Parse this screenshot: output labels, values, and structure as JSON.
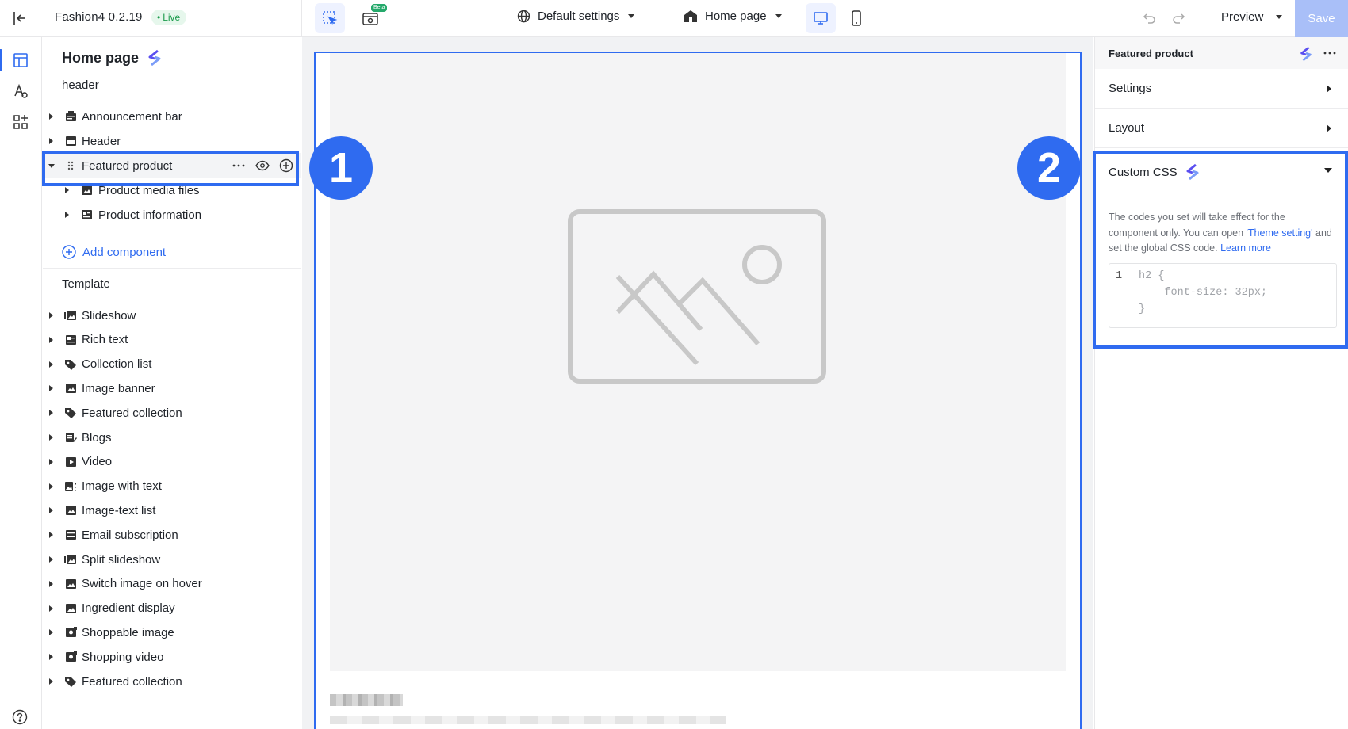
{
  "topbar": {
    "app_name": "Fashion4 0.2.19",
    "live_label": "Live",
    "beta_label": "Beta",
    "settings_dropdown": "Default settings",
    "page_dropdown": "Home page",
    "preview_label": "Preview",
    "save_label": "Save"
  },
  "left_panel": {
    "title": "Home page",
    "header_section": "header",
    "header_items": [
      {
        "label": "Announcement bar",
        "icon": "announcement-icon"
      },
      {
        "label": "Header",
        "icon": "header-icon"
      },
      {
        "label": "Featured product",
        "icon": "drag-handle-icon",
        "expanded": true
      }
    ],
    "featured_children": [
      {
        "label": "Product media files",
        "icon": "image-icon"
      },
      {
        "label": "Product information",
        "icon": "info-block-icon"
      }
    ],
    "add_component": "Add component",
    "template_section": "Template",
    "template_items": [
      {
        "label": "Slideshow",
        "icon": "slideshow-icon"
      },
      {
        "label": "Rich text",
        "icon": "text-block-icon"
      },
      {
        "label": "Collection list",
        "icon": "tag-icon"
      },
      {
        "label": "Image banner",
        "icon": "image-icon"
      },
      {
        "label": "Featured collection",
        "icon": "tag-icon"
      },
      {
        "label": "Blogs",
        "icon": "blog-icon"
      },
      {
        "label": "Video",
        "icon": "video-icon"
      },
      {
        "label": "Image with text",
        "icon": "image-text-icon"
      },
      {
        "label": "Image-text list",
        "icon": "image-icon"
      },
      {
        "label": "Email subscription",
        "icon": "email-icon"
      },
      {
        "label": "Split slideshow",
        "icon": "slideshow-icon"
      },
      {
        "label": "Switch image on hover",
        "icon": "image-icon"
      },
      {
        "label": "Ingredient display",
        "icon": "image-icon"
      },
      {
        "label": "Shoppable image",
        "icon": "shoppable-icon"
      },
      {
        "label": "Shopping video",
        "icon": "shoppable-icon"
      },
      {
        "label": "Featured collection",
        "icon": "tag-icon"
      }
    ]
  },
  "callouts": {
    "one": "1",
    "two": "2"
  },
  "right_panel": {
    "title": "Featured product",
    "settings": "Settings",
    "layout": "Layout",
    "custom_css": "Custom CSS",
    "desc_part1": "The codes you set will take effect for the component only. You can open ",
    "desc_link1": "'Theme setting'",
    "desc_part2": " and set the global CSS code. ",
    "desc_link2": "Learn more",
    "code_line_no": "1",
    "code_line1": "h2 {",
    "code_line2": "    font-size: 32px;",
    "code_line3": "}"
  },
  "colors": {
    "accent": "#2f6bf0",
    "save_disabled": "#a9bff8",
    "live_green": "#1a9b4b"
  }
}
